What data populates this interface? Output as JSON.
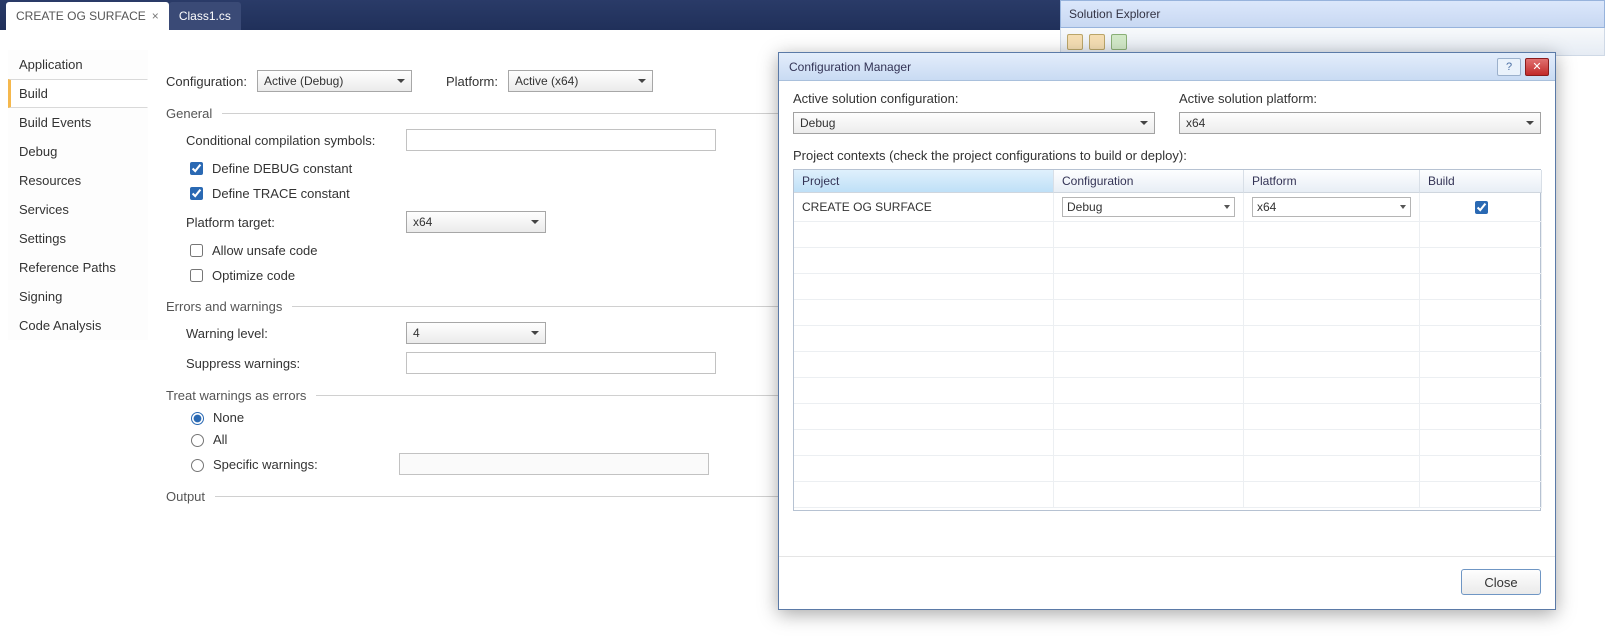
{
  "tabs": {
    "active": "CREATE OG SURFACE",
    "second": "Class1.cs"
  },
  "solution_explorer": {
    "title": "Solution Explorer"
  },
  "props_sidebar": {
    "items": [
      "Application",
      "Build",
      "Build Events",
      "Debug",
      "Resources",
      "Services",
      "Settings",
      "Reference Paths",
      "Signing",
      "Code Analysis"
    ],
    "selected": "Build"
  },
  "build": {
    "configuration_label": "Configuration:",
    "configuration_value": "Active (Debug)",
    "platform_label": "Platform:",
    "platform_value": "Active (x64)",
    "general_section": "General",
    "ccs_label": "Conditional compilation symbols:",
    "ccs_value": "",
    "debug_const": "Define DEBUG constant",
    "trace_const": "Define TRACE constant",
    "platform_target_label": "Platform target:",
    "platform_target_value": "x64",
    "allow_unsafe": "Allow unsafe code",
    "optimize": "Optimize code",
    "errors_section": "Errors and warnings",
    "warning_level_label": "Warning level:",
    "warning_level_value": "4",
    "suppress_label": "Suppress warnings:",
    "suppress_value": "",
    "treat_section": "Treat warnings as errors",
    "radio_none": "None",
    "radio_all": "All",
    "radio_specific": "Specific warnings:",
    "output_section": "Output"
  },
  "dialog": {
    "title": "Configuration Manager",
    "asc_label": "Active solution configuration:",
    "asc_value": "Debug",
    "asp_label": "Active solution platform:",
    "asp_value": "x64",
    "contexts_label": "Project contexts (check the project configurations to build or deploy):",
    "cols": {
      "project": "Project",
      "config": "Configuration",
      "platform": "Platform",
      "build": "Build"
    },
    "row": {
      "project": "CREATE OG SURFACE",
      "config": "Debug",
      "platform": "x64",
      "build_checked": true
    },
    "close": "Close",
    "help_glyph": "?",
    "close_glyph": "✕"
  }
}
